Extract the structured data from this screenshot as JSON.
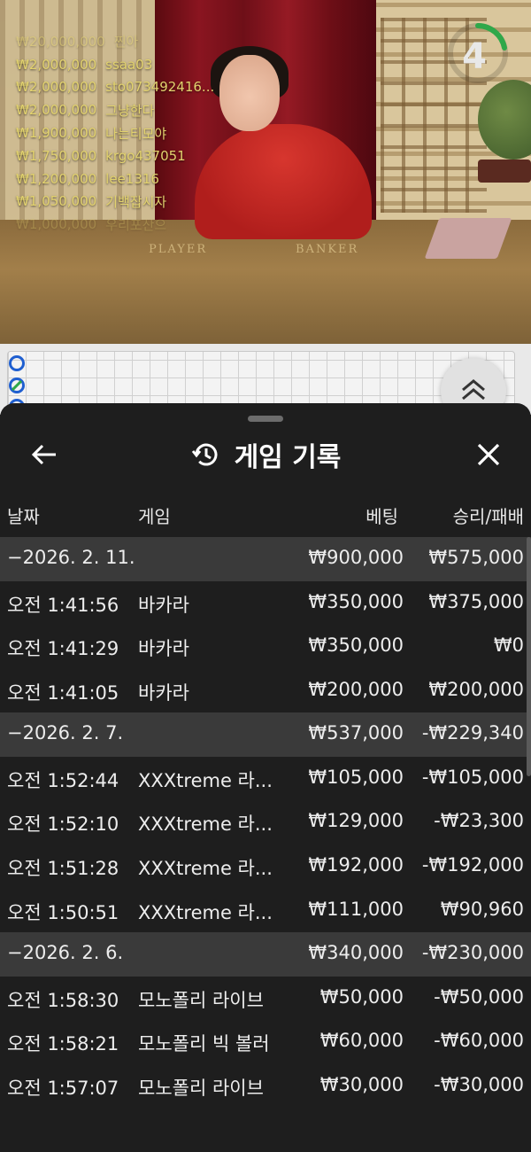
{
  "stream": {
    "timer": "4",
    "table_labels": {
      "player": "PLAYER",
      "banker": "BANKER"
    },
    "bet_feed": [
      {
        "amount": "₩20,000,000",
        "user": "찐아"
      },
      {
        "amount": "₩2,000,000",
        "user": "ssaa03"
      },
      {
        "amount": "₩2,000,000",
        "user": "sto073492416..."
      },
      {
        "amount": "₩2,000,000",
        "user": "그냥한다"
      },
      {
        "amount": "₩1,900,000",
        "user": "나는티모야"
      },
      {
        "amount": "₩1,750,000",
        "user": "krgo437051"
      },
      {
        "amount": "₩1,200,000",
        "user": "lee1316"
      },
      {
        "amount": "₩1,050,000",
        "user": "기백잡시자"
      },
      {
        "amount": "₩1,000,000",
        "user": "우리포산으"
      }
    ]
  },
  "sheet": {
    "title": "게임 기록",
    "columns": {
      "date": "날짜",
      "game": "게임",
      "bet": "베팅",
      "result": "승리/패배"
    },
    "rows": [
      {
        "type": "group",
        "date": "−2026. 2. 11.",
        "bet": "₩900,000",
        "result": "₩575,000"
      },
      {
        "type": "item",
        "date": "오전 1:41:56",
        "game": "바카라",
        "bet": "₩350,000",
        "result": "₩375,000"
      },
      {
        "type": "item",
        "date": "오전 1:41:29",
        "game": "바카라",
        "bet": "₩350,000",
        "result": "₩0"
      },
      {
        "type": "item",
        "date": "오전 1:41:05",
        "game": "바카라",
        "bet": "₩200,000",
        "result": "₩200,000"
      },
      {
        "type": "group",
        "date": "−2026. 2. 7.",
        "bet": "₩537,000",
        "result": "-₩229,340"
      },
      {
        "type": "item",
        "date": "오전 1:52:44",
        "game": "XXXtreme 라...",
        "bet": "₩105,000",
        "result": "-₩105,000"
      },
      {
        "type": "item",
        "date": "오전 1:52:10",
        "game": "XXXtreme 라...",
        "bet": "₩129,000",
        "result": "-₩23,300"
      },
      {
        "type": "item",
        "date": "오전 1:51:28",
        "game": "XXXtreme 라...",
        "bet": "₩192,000",
        "result": "-₩192,000"
      },
      {
        "type": "item",
        "date": "오전 1:50:51",
        "game": "XXXtreme 라...",
        "bet": "₩111,000",
        "result": "₩90,960"
      },
      {
        "type": "group",
        "date": "−2026. 2. 6.",
        "bet": "₩340,000",
        "result": "-₩230,000"
      },
      {
        "type": "item",
        "date": "오전 1:58:30",
        "game": "모노폴리 라이브",
        "bet": "₩50,000",
        "result": "-₩50,000"
      },
      {
        "type": "item",
        "date": "오전 1:58:21",
        "game": "모노폴리 빅 볼러",
        "bet": "₩60,000",
        "result": "-₩60,000"
      },
      {
        "type": "item",
        "date": "오전 1:57:07",
        "game": "모노폴리 라이브",
        "bet": "₩30,000",
        "result": "-₩30,000"
      }
    ]
  },
  "colors": {
    "sheet_bg": "#1e1e1e",
    "group_row_bg": "#3a3a3a",
    "feed_text": "#e2d26e",
    "timer_ring": "#2fa84a"
  }
}
